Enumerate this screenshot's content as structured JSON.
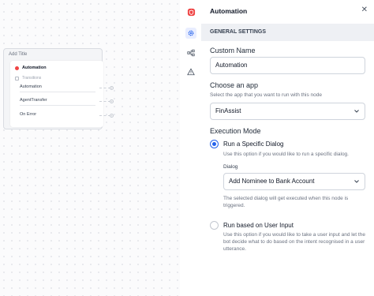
{
  "canvas": {
    "node": {
      "title": "Add Title",
      "name": "Automation",
      "transitions_label": "Transitions",
      "transitions": [
        "Automation",
        "AgentTransfer",
        "On Error"
      ]
    }
  },
  "toolbar": {
    "icons": [
      "shield-icon",
      "gear-icon",
      "hierarchy-icon",
      "warning-icon"
    ],
    "active": "gear-icon"
  },
  "panel": {
    "title": "Automation",
    "section_title": "GENERAL SETTINGS",
    "custom_name_label": "Custom Name",
    "custom_name_value": "Automation",
    "choose_app_label": "Choose an app",
    "choose_app_help": "Select the app that you want to run with this node",
    "app_selected": "FinAssist",
    "execution_mode_label": "Execution Mode",
    "options": [
      {
        "label": "Run a Specific Dialog",
        "help": "Use this option if you would like to run a specific dialog.",
        "selected": true
      },
      {
        "label": "Run based on User Input",
        "help": "Use this option if you would like to take a user input and let the bot decide what to do based on the intent recognised in a user utterance.",
        "selected": false
      }
    ],
    "dialog_label": "Dialog",
    "dialog_selected": "Add Nominee to Bank Account",
    "dialog_help": "The selected dialog will get executed when this node is triggered."
  },
  "colors": {
    "accent": "#2563eb",
    "danger": "#ef4444",
    "section_bg": "#eef0f4"
  }
}
